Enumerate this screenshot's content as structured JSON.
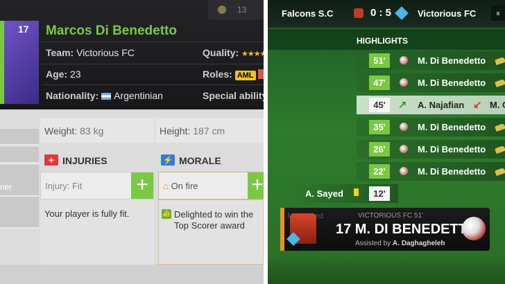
{
  "player": {
    "number": "17",
    "name": "Marcos Di Benedetto",
    "team_label": "Team:",
    "team": "Victorious FC",
    "age_label": "Age:",
    "age": "23",
    "nationality_label": "Nationality:",
    "nationality": "Argentinian",
    "quality_label": "Quality:",
    "quality_stars": "★★★★★",
    "roles_label": "Roles:",
    "role": "AML",
    "special_label": "Special ability",
    "coins": "13"
  },
  "sidebar": {
    "partial_label": "ner"
  },
  "stats": {
    "weight_label": "Weight:",
    "weight": "83 kg",
    "height_label": "Height:",
    "height": "187 cm"
  },
  "injuries": {
    "title": "INJURIES",
    "status_label": "Injury:",
    "status": "Fit",
    "message": "Your player is fully fit."
  },
  "morale": {
    "title": "MORALE",
    "status": "On fire",
    "message": "Delighted to win the Top Scorer award"
  },
  "match": {
    "home": "Falcons S.C",
    "score": "0 : 5",
    "away": "Victorious FC",
    "highlights_title": "HIGHLIGHTS",
    "events": [
      {
        "minute": "51'",
        "player": "M. Di Benedetto",
        "type": "goal"
      },
      {
        "minute": "47'",
        "player": "M. Di Benedetto",
        "type": "goal"
      },
      {
        "minute": "45'",
        "player": "A. Najafian",
        "type": "sub",
        "extra": "M. C"
      },
      {
        "minute": "35'",
        "player": "M. Di Benedetto",
        "type": "goal"
      },
      {
        "minute": "26'",
        "player": "M. Di Benedetto",
        "type": "goal"
      },
      {
        "minute": "22'",
        "player": "M. Di Benedetto",
        "type": "goal"
      }
    ],
    "card_event": {
      "minute": "12'",
      "player": "A. Sayed"
    },
    "popup": {
      "faded": "M...started",
      "team_minute": "VICTORIOUS FC 51'",
      "headline": "17 M. DI BENEDETTO",
      "assist_label": "Assisted by",
      "assist": "A. Daghagheleh"
    }
  },
  "colors": {
    "accent_green": "#7ac943",
    "morale_blue": "#2f7fd8",
    "injury_red": "#e03a3a",
    "gold": "#f2c21b"
  }
}
